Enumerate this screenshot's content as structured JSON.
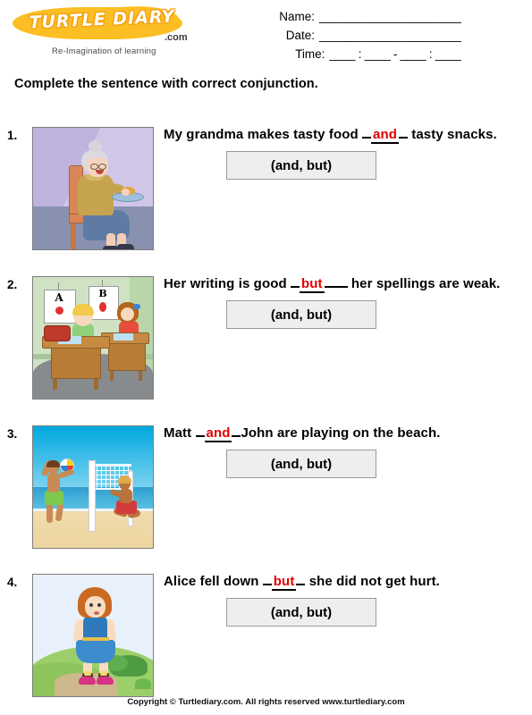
{
  "brand": {
    "logo_text": "TURTLE DIARY",
    "logo_suffix": ".com",
    "tagline": "Re-Imagination of learning",
    "logo_color": "#FBBF24"
  },
  "header": {
    "fields": [
      {
        "label": "Name:",
        "rule": "______________________"
      },
      {
        "label": "Date:",
        "rule": "______________________"
      },
      {
        "label": "Time:",
        "rule": "____ : ____ - ____ : ____"
      }
    ]
  },
  "instruction": "Complete the sentence with correct conjunction.",
  "answer_color": "#e00000",
  "questions": [
    {
      "number": "1.",
      "image_alt": "grandma sitting on chair holding plate of food",
      "before": "My grandma makes tasty food ",
      "answer": "and",
      "after": " tasty snacks.",
      "choices": "(and, but)"
    },
    {
      "number": "2.",
      "image_alt": "two children writing at classroom desks with A and B posters",
      "before": "Her writing is good ",
      "answer": "but",
      "after": " her spellings are weak.",
      "choices": "(and, but)"
    },
    {
      "number": "3.",
      "image_alt": "two boys playing volleyball on the beach",
      "before": "Matt ",
      "answer": "and",
      "after": "John are playing on the beach.",
      "choices": "(and, but)"
    },
    {
      "number": "4.",
      "image_alt": "girl in blue dress brushing off skirt on grassy hill",
      "before": "Alice fell down ",
      "answer": "but",
      "after": " she did not get hurt.",
      "choices": "(and, but)"
    }
  ],
  "footer": "Copyright © Turtlediary.com. All rights reserved  www.turtlediary.com"
}
